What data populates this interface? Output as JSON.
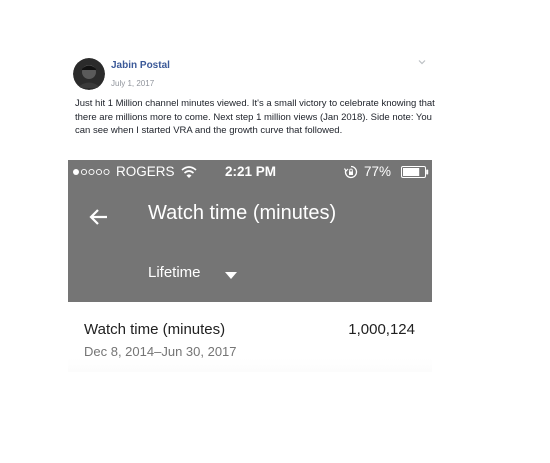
{
  "post": {
    "author": "Jabin Postal",
    "date": "July 1, 2017",
    "text": "Just hit 1 Million channel minutes viewed. It's a small victory to celebrate knowing that there are millions more to come. Next step 1 million views (Jan 2018). Side note: You can see when I started VRA and the growth curve that followed.",
    "menu_icon": "chevron-down-icon",
    "avatar_icon": "user-avatar"
  },
  "phone": {
    "status": {
      "signal_icon": "signal-dots-icon",
      "carrier": "ROGERS",
      "wifi_icon": "wifi-icon",
      "time": "2:21 PM",
      "lock_icon": "rotation-lock-icon",
      "battery_pct": "77%",
      "battery_icon": "battery-icon",
      "battery_level": 0.77
    },
    "appbar": {
      "back_icon": "arrow-left-icon",
      "title": "Watch time (minutes)",
      "range_label": "Lifetime",
      "range_icon": "caret-down-icon"
    },
    "metric": {
      "label": "Watch time (minutes)",
      "value": "1,000,124",
      "range": "Dec 8, 2014–Jun 30, 2017"
    }
  },
  "colors": {
    "appbar_bg": "#757575",
    "author_link": "#3b5998",
    "secondary_text": "#90949c"
  }
}
